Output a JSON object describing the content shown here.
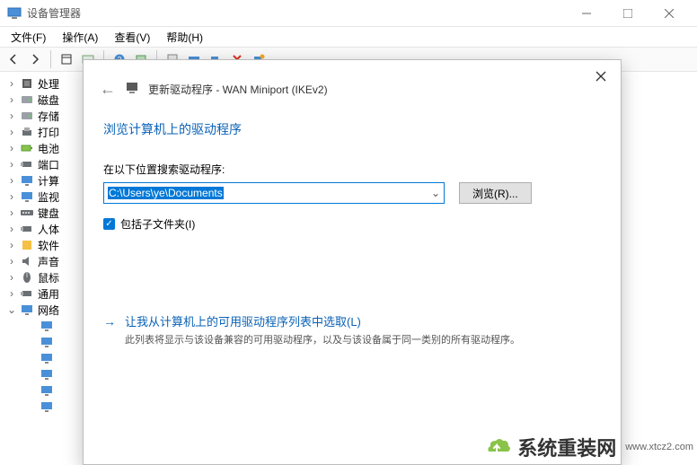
{
  "window": {
    "title": "设备管理器",
    "min": "−",
    "max": "□",
    "close": "✕"
  },
  "menu": {
    "file": "文件(F)",
    "action": "操作(A)",
    "view": "查看(V)",
    "help": "帮助(H)"
  },
  "tree": {
    "items": [
      {
        "icon": "cpu",
        "label": "处理",
        "expander": ">"
      },
      {
        "icon": "drive",
        "label": "磁盘",
        "expander": ">"
      },
      {
        "icon": "drive",
        "label": "存储",
        "expander": ">"
      },
      {
        "icon": "printer",
        "label": "打印",
        "expander": ">"
      },
      {
        "icon": "batt",
        "label": "电池",
        "expander": ">"
      },
      {
        "icon": "usb",
        "label": "端口",
        "expander": ">"
      },
      {
        "icon": "mon",
        "label": "计算",
        "expander": ">"
      },
      {
        "icon": "mon",
        "label": "监视",
        "expander": ">"
      },
      {
        "icon": "kbd",
        "label": "键盘",
        "expander": ">"
      },
      {
        "icon": "usb",
        "label": "人体",
        "expander": ">"
      },
      {
        "icon": "yellow",
        "label": "软件",
        "expander": ">"
      },
      {
        "icon": "speaker",
        "label": "声音",
        "expander": ">"
      },
      {
        "icon": "mouse",
        "label": "鼠标",
        "expander": ">"
      },
      {
        "icon": "usb",
        "label": "通用",
        "expander": ">"
      },
      {
        "icon": "net",
        "label": "网络",
        "expander": "v"
      }
    ],
    "net_children_count": 6
  },
  "dialog": {
    "header": "更新驱动程序 - WAN Miniport (IKEv2)",
    "heading": "浏览计算机上的驱动程序",
    "search_label": "在以下位置搜索驱动程序:",
    "path": "C:\\Users\\ye\\Documents",
    "browse": "浏览(R)...",
    "include_sub": "包括子文件夹(I)",
    "link_title": "让我从计算机上的可用驱动程序列表中选取(L)",
    "link_desc": "此列表将显示与该设备兼容的可用驱动程序，以及与该设备属于同一类别的所有驱动程序。"
  },
  "watermark": {
    "text": "系统重装网",
    "url": "www.xtcz2.com"
  }
}
